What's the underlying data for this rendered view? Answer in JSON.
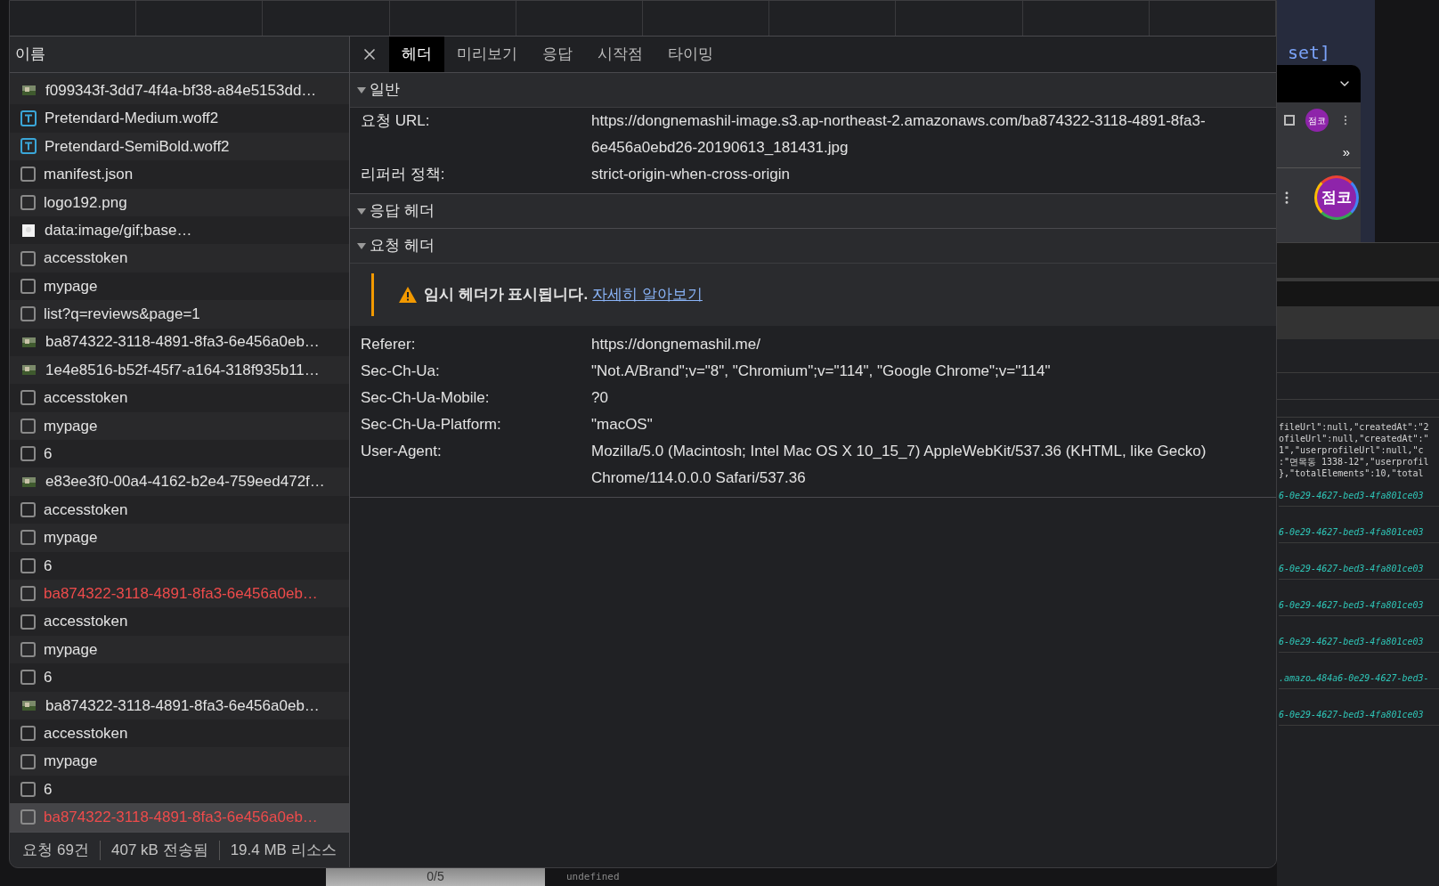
{
  "request_list": {
    "header": "이름",
    "rows": [
      {
        "name": "f099343f-3dd7-4f4a-bf38-a84e5153dd…",
        "kind": "image",
        "error": false,
        "selected": false
      },
      {
        "name": "Pretendard-Medium.woff2",
        "kind": "font",
        "error": false,
        "selected": false
      },
      {
        "name": "Pretendard-SemiBold.woff2",
        "kind": "font",
        "error": false,
        "selected": false
      },
      {
        "name": "manifest.json",
        "kind": "doc",
        "error": false,
        "selected": false
      },
      {
        "name": "logo192.png",
        "kind": "doc",
        "error": false,
        "selected": false
      },
      {
        "name": "data:image/gif;base…",
        "kind": "blank-image",
        "error": false,
        "selected": false
      },
      {
        "name": "accesstoken",
        "kind": "doc",
        "error": false,
        "selected": false
      },
      {
        "name": "mypage",
        "kind": "doc",
        "error": false,
        "selected": false
      },
      {
        "name": "list?q=reviews&page=1",
        "kind": "doc",
        "error": false,
        "selected": false
      },
      {
        "name": "ba874322-3118-4891-8fa3-6e456a0eb…",
        "kind": "image",
        "error": false,
        "selected": false
      },
      {
        "name": "1e4e8516-b52f-45f7-a164-318f935b11…",
        "kind": "image",
        "error": false,
        "selected": false
      },
      {
        "name": "accesstoken",
        "kind": "doc",
        "error": false,
        "selected": false
      },
      {
        "name": "mypage",
        "kind": "doc",
        "error": false,
        "selected": false
      },
      {
        "name": "6",
        "kind": "doc",
        "error": false,
        "selected": false
      },
      {
        "name": "e83ee3f0-00a4-4162-b2e4-759eed472f…",
        "kind": "image",
        "error": false,
        "selected": false
      },
      {
        "name": "accesstoken",
        "kind": "doc",
        "error": false,
        "selected": false
      },
      {
        "name": "mypage",
        "kind": "doc",
        "error": false,
        "selected": false
      },
      {
        "name": "6",
        "kind": "doc",
        "error": false,
        "selected": false
      },
      {
        "name": "ba874322-3118-4891-8fa3-6e456a0eb…",
        "kind": "doc",
        "error": true,
        "selected": false
      },
      {
        "name": "accesstoken",
        "kind": "doc",
        "error": false,
        "selected": false
      },
      {
        "name": "mypage",
        "kind": "doc",
        "error": false,
        "selected": false
      },
      {
        "name": "6",
        "kind": "doc",
        "error": false,
        "selected": false
      },
      {
        "name": "ba874322-3118-4891-8fa3-6e456a0eb…",
        "kind": "image",
        "error": false,
        "selected": false
      },
      {
        "name": "accesstoken",
        "kind": "doc",
        "error": false,
        "selected": false
      },
      {
        "name": "mypage",
        "kind": "doc",
        "error": false,
        "selected": false
      },
      {
        "name": "6",
        "kind": "doc",
        "error": false,
        "selected": false
      },
      {
        "name": "ba874322-3118-4891-8fa3-6e456a0eb…",
        "kind": "doc",
        "error": true,
        "selected": true
      }
    ]
  },
  "status_bar": [
    "요청 69건",
    "407 kB 전송됨",
    "19.4 MB 리소스"
  ],
  "detail": {
    "tabs": [
      {
        "label": "헤더",
        "selected": true
      },
      {
        "label": "미리보기",
        "selected": false
      },
      {
        "label": "응답",
        "selected": false
      },
      {
        "label": "시작점",
        "selected": false
      },
      {
        "label": "타이밍",
        "selected": false
      }
    ],
    "sections": [
      {
        "title": "일반",
        "expanded": true,
        "fields": [
          {
            "key": "요청 URL:",
            "value": "https://dongnemashil-image.s3.ap-northeast-2.amazonaws.com/ba874322-3118-4891-8fa3-6e456a0ebd26-20190613_181431.jpg"
          },
          {
            "key": "리퍼러 정책:",
            "value": "strict-origin-when-cross-origin"
          }
        ]
      },
      {
        "title": "응답 헤더",
        "expanded": true
      },
      {
        "title": "요청 헤더",
        "expanded": true,
        "warning": {
          "text": "임시 헤더가 표시됩니다.",
          "link": "자세히 알아보기"
        },
        "fields": [
          {
            "key": "Referer:",
            "value": "https://dongnemashil.me/"
          },
          {
            "key": "Sec-Ch-Ua:",
            "value": "\"Not.A/Brand\";v=\"8\", \"Chromium\";v=\"114\", \"Google Chrome\";v=\"114\""
          },
          {
            "key": "Sec-Ch-Ua-Mobile:",
            "value": "?0"
          },
          {
            "key": "Sec-Ch-Ua-Platform:",
            "value": "\"macOS\""
          },
          {
            "key": "User-Agent:",
            "value": "Mozilla/5.0 (Macintosh; Intel Mac OS X 10_15_7) AppleWebKit/537.36 (KHTML, like Gecko) Chrome/114.0.0.0 Safari/537.36"
          }
        ]
      }
    ]
  },
  "background": {
    "editor_text": "set]",
    "popup": {
      "avatar_small": "점코",
      "more": "»",
      "avatar_large": "점코"
    },
    "console_lines": [
      "fileUrl\":null,\"createdAt\":\"2",
      "ofileUrl\":null,\"createdAt\":\"",
      "1\",\"userprofileUrl\":null,\"c",
      ":\"면목동 1338-12\",\"userprofil",
      "},\"totalElements\":10,\"total"
    ],
    "link_lines": [
      "6-0e29-4627-bed3-4fa801ce03",
      "6-0e29-4627-bed3-4fa801ce03",
      "6-0e29-4627-bed3-4fa801ce03",
      "6-0e29-4627-bed3-4fa801ce03",
      "6-0e29-4627-bed3-4fa801ce03",
      ".amazo…484a6-0e29-4627-bed3-",
      "6-0e29-4627-bed3-4fa801ce03"
    ],
    "pager": "0/5",
    "cell": "undefined"
  }
}
